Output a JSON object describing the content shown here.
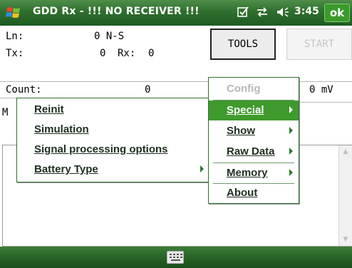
{
  "titlebar": {
    "app_title": "GDD Rx - !!! NO RECEIVER !!!",
    "icons": [
      "windows-logo-icon",
      "tasks-icon",
      "connectivity-icon",
      "volume-icon"
    ],
    "clock": "3:45",
    "ok_label": "ok"
  },
  "readouts": {
    "ln_label": "Ln:",
    "ln_value": "0 N-S",
    "tx_label": "Tx:",
    "tx_value": "0",
    "rx_label": "Rx:",
    "rx_value": "0",
    "count_label": "Count:",
    "count_value": "0",
    "m_prefix": "M",
    "mv_value": "0 mV"
  },
  "buttons": {
    "tools": "TOOLS",
    "start": "START"
  },
  "main_menu": {
    "items": [
      {
        "label": "Config",
        "enabled": false,
        "submenu": false
      },
      {
        "label": "Special",
        "enabled": true,
        "submenu": true,
        "selected": true
      },
      {
        "label": "Show",
        "enabled": true,
        "submenu": true
      },
      {
        "label": "Raw Data",
        "enabled": true,
        "submenu": true
      },
      {
        "label": "Memory",
        "enabled": true,
        "submenu": true
      },
      {
        "label": "About",
        "enabled": true,
        "submenu": false
      }
    ]
  },
  "special_submenu": {
    "items": [
      {
        "label": "Reinit",
        "submenu": false
      },
      {
        "label": "Simulation",
        "submenu": false
      },
      {
        "label": "Signal processing options",
        "submenu": false
      },
      {
        "label": "Battery Type",
        "submenu": true
      }
    ]
  },
  "colors": {
    "titlebar_green": "#2f6f2e",
    "selected_green": "#3f9a2d",
    "ok_green": "#3a9a2b"
  }
}
